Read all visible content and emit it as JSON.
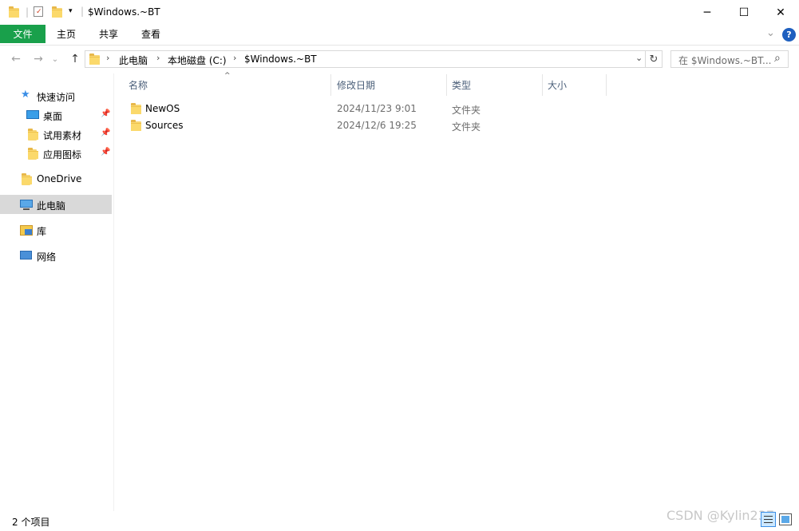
{
  "window": {
    "title": "$Windows.~BT",
    "minimize_glyph": "─",
    "maximize_glyph": "☐",
    "close_glyph": "✕"
  },
  "ribbon": {
    "tabs": [
      {
        "label": "文件",
        "active": true
      },
      {
        "label": "主页"
      },
      {
        "label": "共享"
      },
      {
        "label": "查看"
      }
    ],
    "expand_glyph": "⌄",
    "help_glyph": "?"
  },
  "address": {
    "back_glyph": "←",
    "forward_glyph": "→",
    "recent_glyph": "⌄",
    "up_glyph": "↑",
    "breadcrumbs": [
      "此电脑",
      "本地磁盘 (C:)",
      "$Windows.~BT"
    ],
    "sep_glyph": "›",
    "dropdown_glyph": "⌄",
    "refresh_glyph": "↻",
    "search_placeholder": "在 $Windows.~BT...",
    "search_icon_glyph": "⌕"
  },
  "sidebar": {
    "quick_access": "快速访问",
    "pinned": [
      {
        "label": "桌面"
      },
      {
        "label": "试用素材"
      },
      {
        "label": "应用图标"
      }
    ],
    "pin_glyph": "📌",
    "onedrive": "OneDrive",
    "thispc": "此电脑",
    "libraries": "库",
    "network": "网络"
  },
  "columns": {
    "name": "名称",
    "modified": "修改日期",
    "type": "类型",
    "size": "大小",
    "sort_glyph": "^"
  },
  "files": [
    {
      "name": "NewOS",
      "modified": "2024/11/23 9:01",
      "type": "文件夹"
    },
    {
      "name": "Sources",
      "modified": "2024/12/6 19:25",
      "type": "文件夹"
    }
  ],
  "status": {
    "item_count": "2 个项目",
    "watermark": "CSDN @Kylin237"
  },
  "colors": {
    "file_tab": "#19a04b",
    "selected_nav": "#d9d9d9",
    "help": "#1e5fbf"
  }
}
